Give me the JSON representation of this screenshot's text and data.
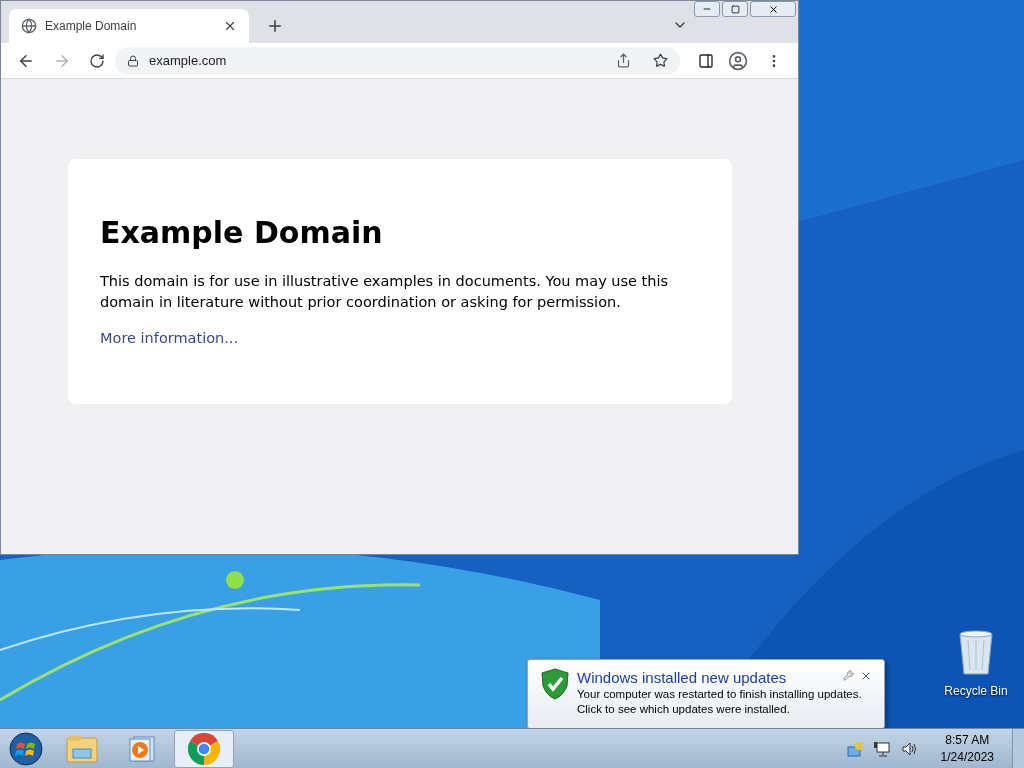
{
  "browser": {
    "tabs": [
      {
        "title": "Example Domain",
        "selected": true
      }
    ],
    "address": "example.com",
    "page": {
      "heading": "Example Domain",
      "body": "This domain is for use in illustrative examples in documents. You may use this domain in literature without prior coordination or asking for permission.",
      "link": "More information..."
    }
  },
  "notification": {
    "title": "Windows installed new updates",
    "lines": [
      "Your computer was restarted to finish installing updates.",
      "Click to see which updates were installed."
    ]
  },
  "desktop_icons": [
    {
      "label": "Recycle Bin"
    }
  ],
  "taskbar": {
    "items": [
      {
        "kind": "start",
        "active": false
      },
      {
        "kind": "explorer",
        "active": false
      },
      {
        "kind": "media",
        "active": false
      },
      {
        "kind": "chrome",
        "active": true
      }
    ],
    "time": "8:57 AM",
    "date": "1/24/2023"
  }
}
